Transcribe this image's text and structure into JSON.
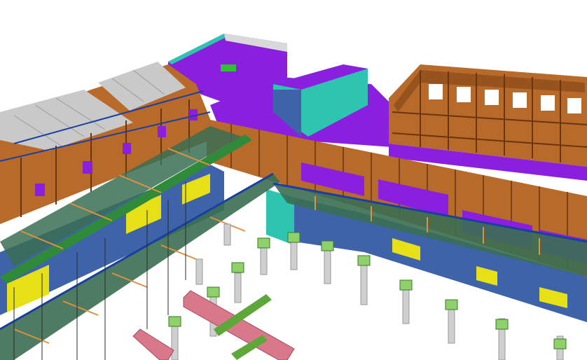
{
  "colors": {
    "background": "#ffffff",
    "roof_deck": "#8a1fe0",
    "roof_deck_dark": "#6d18b5",
    "teal_wall": "#2ec4b0",
    "blue_wall": "#3f63a8",
    "timber_frame": "#b86a2a",
    "timber_dark": "#7a3f12",
    "steel_green": "#2f8a3a",
    "steel_grate": "#3a6e52",
    "yellow_panel": "#e8e017",
    "concrete_column": "#cfcfcf",
    "footing_green": "#8fd06a",
    "grade_beam_red": "#d9788a",
    "skylight_grey": "#c9c9c9"
  }
}
